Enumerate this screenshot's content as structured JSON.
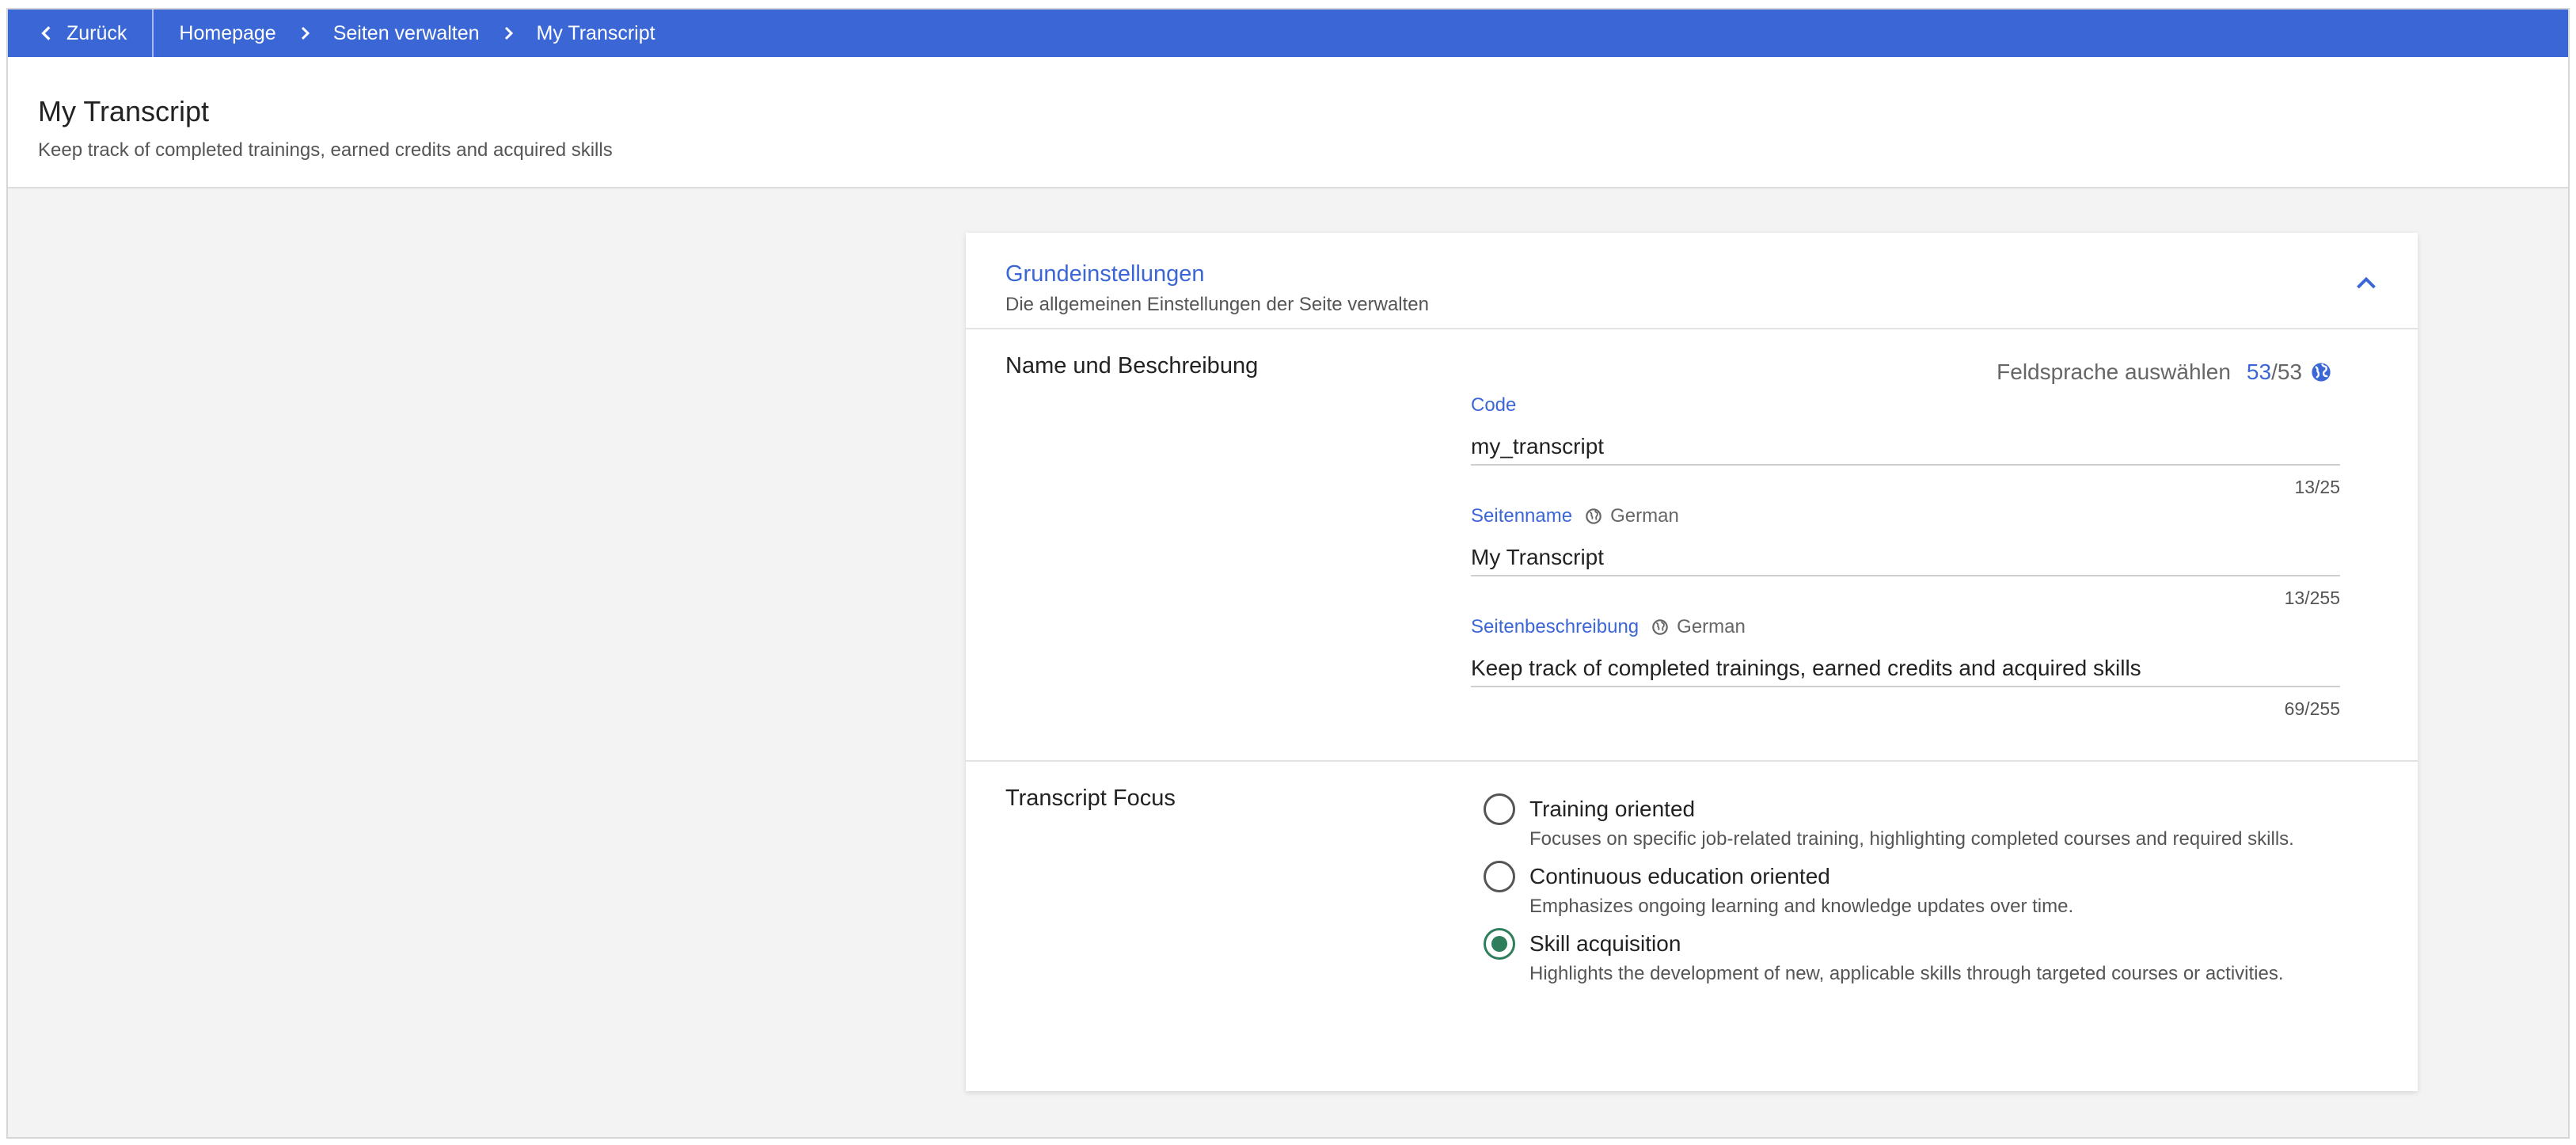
{
  "nav": {
    "back_label": "Zurück",
    "breadcrumbs": [
      "Homepage",
      "Seiten verwalten",
      "My Transcript"
    ]
  },
  "header": {
    "title": "My Transcript",
    "subtitle": "Keep track of completed trainings, earned credits and acquired skills"
  },
  "card": {
    "title": "Grundeinstellungen",
    "description": "Die allgemeinen Einstellungen der Seite verwalten"
  },
  "name_section": {
    "title": "Name und Beschreibung",
    "language_select_label": "Feldsprache auswählen",
    "language_count": "53",
    "language_total": "/53",
    "fields": {
      "code": {
        "label": "Code",
        "value": "my_transcript",
        "counter": "13/25"
      },
      "page_name": {
        "label": "Seitenname",
        "language": "German",
        "value": "My Transcript",
        "counter": "13/255"
      },
      "page_description": {
        "label": "Seitenbeschreibung",
        "language": "German",
        "value": "Keep track of completed trainings, earned credits and acquired skills",
        "counter": "69/255"
      }
    }
  },
  "focus_section": {
    "title": "Transcript Focus",
    "options": [
      {
        "label": "Training oriented",
        "description": "Focuses on specific job-related training, highlighting completed courses and required skills.",
        "selected": false
      },
      {
        "label": "Continuous education oriented",
        "description": "Emphasizes ongoing learning and knowledge updates over time.",
        "selected": false
      },
      {
        "label": "Skill acquisition",
        "description": "Highlights the development of new, applicable skills through targeted courses or activities.",
        "selected": true
      }
    ]
  },
  "icons": {
    "back": "chevron-left-icon",
    "breadcrumb_separator": "chevron-right-icon",
    "collapse": "chevron-up-icon",
    "language": "globe-icon"
  },
  "colors": {
    "topbar": "#3b67d6",
    "accent": "#3b67d6",
    "radio_selected": "#2e7d5b",
    "background": "#f3f3f3"
  }
}
